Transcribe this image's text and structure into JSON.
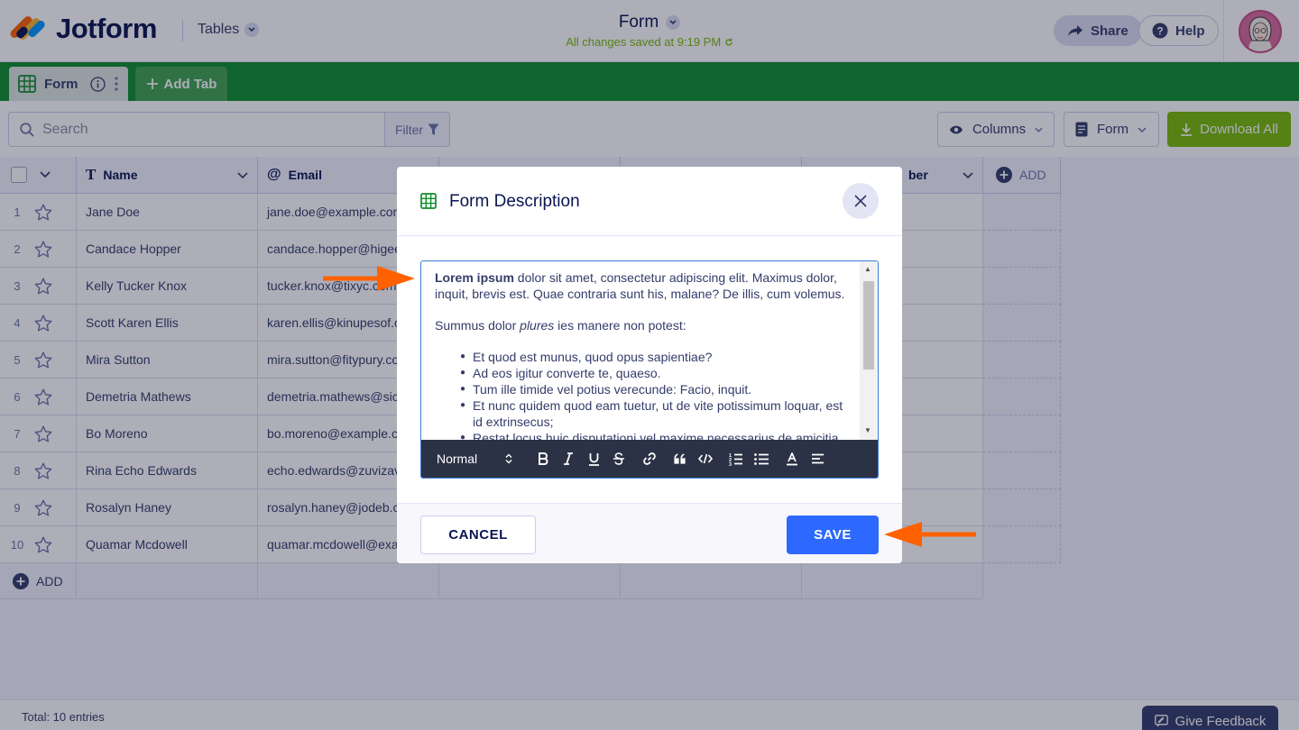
{
  "app": {
    "brand": "Jotform",
    "section": "Tables"
  },
  "header": {
    "form_title": "Form",
    "saved_status": "All changes saved at 9:19 PM",
    "share_label": "Share",
    "help_label": "Help"
  },
  "tabs": {
    "active_label": "Form",
    "add_label": "Add Tab"
  },
  "toolbar": {
    "search_placeholder": "Search",
    "filter_label": "Filter",
    "columns_label": "Columns",
    "form_label": "Form",
    "download_label": "Download All"
  },
  "table": {
    "columns": [
      {
        "label": "Name",
        "icon": "text-type-icon"
      },
      {
        "label": "Email",
        "icon": "at-sign-icon"
      },
      {
        "label": "",
        "icon": ""
      },
      {
        "label": "",
        "icon": ""
      },
      {
        "label": "ber",
        "icon": ""
      }
    ],
    "add_column_label": "ADD",
    "add_row_label": "ADD",
    "rows": [
      {
        "num": "1",
        "name": "Jane Doe",
        "email": "jane.doe@example.com"
      },
      {
        "num": "2",
        "name": "Candace Hopper",
        "email": "candace.hopper@higee"
      },
      {
        "num": "3",
        "name": "Kelly Tucker Knox",
        "email": "tucker.knox@tixyc.com"
      },
      {
        "num": "4",
        "name": "Scott Karen Ellis",
        "email": "karen.ellis@kinupesof.c"
      },
      {
        "num": "5",
        "name": "Mira Sutton",
        "email": "mira.sutton@fitypury.co"
      },
      {
        "num": "6",
        "name": "Demetria Mathews",
        "email": "demetria.mathews@sic"
      },
      {
        "num": "7",
        "name": "Bo Moreno",
        "email": "bo.moreno@example.co"
      },
      {
        "num": "8",
        "name": "Rina Echo Edwards",
        "email": "echo.edwards@zuvizav"
      },
      {
        "num": "9",
        "name": "Rosalyn Haney",
        "email": "rosalyn.haney@jodeb.c"
      },
      {
        "num": "10",
        "name": "Quamar Mcdowell",
        "email": "quamar.mcdowell@exa"
      }
    ]
  },
  "footer": {
    "total": "Total: 10 entries",
    "feedback": "Give Feedback"
  },
  "modal": {
    "title": "Form Description",
    "p1_bold": "Lorem ipsum",
    "p1_rest": " dolor sit amet, consectetur adipiscing elit. Maximus dolor, inquit, brevis est. Quae contraria sunt his, malane? De illis, cum volemus.",
    "p2_before": "Summus dolor ",
    "p2_italic": "plures",
    "p2_after": " ies manere non potest:",
    "bullets": [
      "Et quod est munus, quod opus sapientiae?",
      "Ad eos igitur converte te, quaeso.",
      "Tum ille timide vel potius verecunde: Facio, inquit.",
      "Et nunc quidem quod eam tuetur, ut de vite potissimum loquar, est id extrinsecus;",
      "Restat locus huic disputationi vel maxime necessarius de amicitia."
    ],
    "format_select": "Normal",
    "cancel_label": "CANCEL",
    "save_label": "SAVE"
  },
  "colors": {
    "brand_green": "#0e8e2b",
    "save_blue": "#2e69ff",
    "download_green": "#78bb07",
    "annotation_orange": "#ff6100"
  }
}
